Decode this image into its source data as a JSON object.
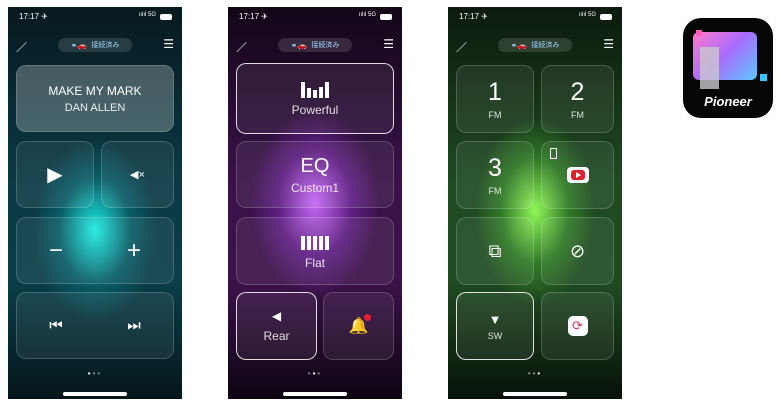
{
  "status": {
    "time": "17:17 ✈",
    "signal": "ıılıl 5G"
  },
  "topbar": {
    "pill_text": "接続済み",
    "car_icon": "car-icon"
  },
  "screen1": {
    "song_title": "MAKE MY MARK",
    "artist": "DAN ALLEN",
    "play": "▶",
    "mute": "◀×",
    "minus": "−",
    "plus": "+",
    "prev": "⏮",
    "next": "⏭",
    "dots": [
      "•",
      "•",
      "•"
    ]
  },
  "screen2": {
    "powerful_label": "Powerful",
    "eq_title": "EQ",
    "eq_preset": "Custom1",
    "flat_label": "Flat",
    "rear_label": "Rear",
    "dots": [
      "•",
      "•",
      "•"
    ]
  },
  "screen3": {
    "tiles": [
      {
        "number": "1",
        "band": "FM"
      },
      {
        "number": "2",
        "band": "FM"
      },
      {
        "number": "3",
        "band": "FM"
      }
    ],
    "sw_label": "SW",
    "dots": [
      "•",
      "•",
      "•"
    ]
  },
  "app_icon": {
    "brand": "Pioneer",
    "colors": {
      "accent_pink": "#ff5fb8",
      "accent_cyan": "#38c8ff"
    }
  }
}
